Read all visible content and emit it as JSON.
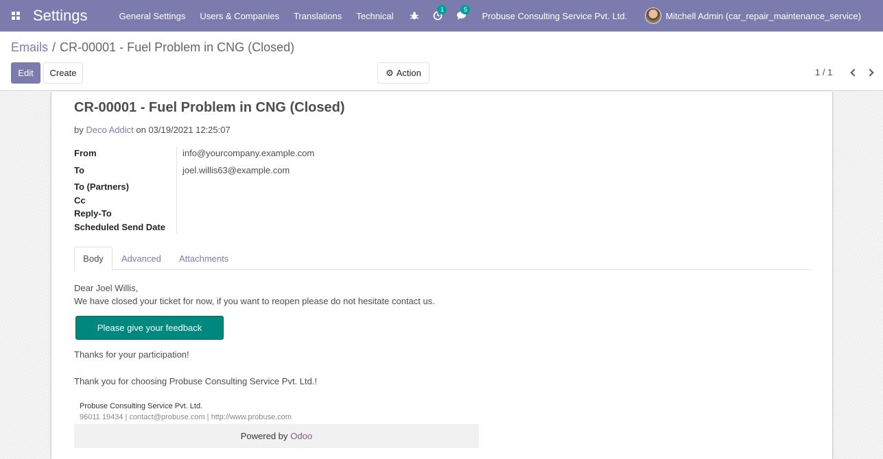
{
  "navbar": {
    "app_title": "Settings",
    "menu": [
      {
        "label": "General Settings"
      },
      {
        "label": "Users & Companies"
      },
      {
        "label": "Translations"
      },
      {
        "label": "Technical"
      }
    ],
    "activity_badge": "1",
    "messages_badge": "5",
    "company": "Probuse Consulting Service Pvt. Ltd.",
    "user": "Mitchell Admin (car_repair_maintenance_service)",
    "color": "#7c7bad"
  },
  "control_panel": {
    "breadcrumb_parent": "Emails",
    "breadcrumb_separator": "/",
    "breadcrumb_current": "CR-00001 - Fuel Problem in CNG (Closed)",
    "edit_label": "Edit",
    "create_label": "Create",
    "action_label": "Action",
    "pager": "1 / 1"
  },
  "mail": {
    "title": "CR-00001 - Fuel Problem in CNG (Closed)",
    "by_prefix": "by",
    "author": "Deco Addict",
    "date_text": "on 03/19/2021 12:25:07",
    "fields": [
      {
        "label": "From",
        "value": "info@yourcompany.example.com"
      },
      {
        "label": "To",
        "value": "joel.willis63@example.com"
      },
      {
        "label": "To (Partners)",
        "value": ""
      },
      {
        "label": "Cc",
        "value": ""
      },
      {
        "label": "Reply-To",
        "value": ""
      },
      {
        "label": "Scheduled Send Date",
        "value": ""
      }
    ],
    "tabs": [
      {
        "label": "Body"
      },
      {
        "label": "Advanced"
      },
      {
        "label": "Attachments"
      }
    ],
    "body": {
      "greeting": "Dear Joel Willis,",
      "line1": "We have closed your ticket for now, if you want to reopen please do not hesitate contact us.",
      "feedback_button": "Please give your feedback",
      "thanks": "Thanks for your participation!",
      "closing": "Thank you for choosing Probuse Consulting Service Pvt. Ltd.!",
      "footer_company": "Probuse Consulting Service Pvt. Ltd.",
      "footer_contact": "96011 19434 | contact@probuse.com | http://www.probuse.com",
      "powered_by": "Powered by",
      "powered_link": "Odoo"
    },
    "feedback_color": "#00877e"
  }
}
